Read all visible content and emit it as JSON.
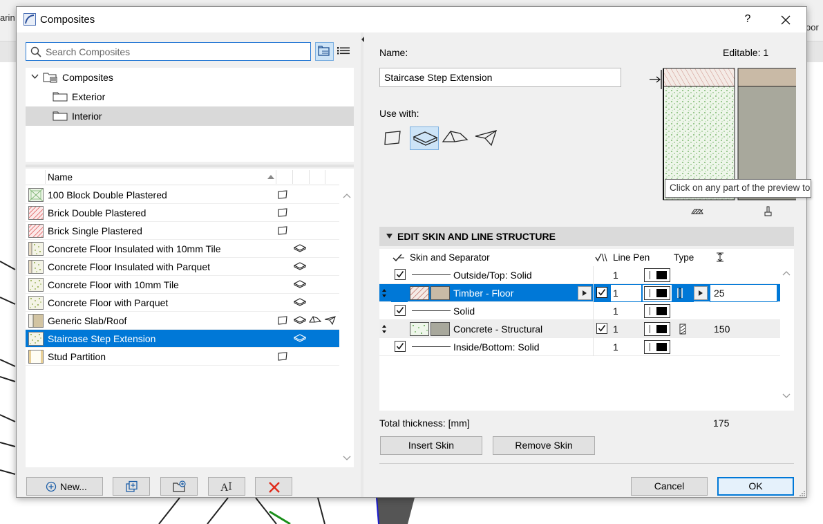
{
  "background": {
    "fragment_left": "arin",
    "fragment_right": "oor"
  },
  "dialog": {
    "title": "Composites",
    "help_label": "?"
  },
  "search": {
    "placeholder": "Search Composites"
  },
  "tree": {
    "root": "Composites",
    "children": [
      "Exterior",
      "Interior"
    ],
    "selected": "Interior"
  },
  "list": {
    "header_name": "Name",
    "rows": [
      {
        "name": "100 Block Double Plastered",
        "swatch": "block",
        "uses": [
          "wall"
        ]
      },
      {
        "name": "Brick Double Plastered",
        "swatch": "brick",
        "uses": [
          "wall"
        ]
      },
      {
        "name": "Brick Single Plastered",
        "swatch": "brick",
        "uses": [
          "wall"
        ]
      },
      {
        "name": "Concrete Floor Insulated with 10mm Tile",
        "swatch": "concrete-insulated",
        "uses": [
          "slab"
        ]
      },
      {
        "name": "Concrete Floor Insulated with Parquet",
        "swatch": "concrete-insulated",
        "uses": [
          "slab"
        ]
      },
      {
        "name": "Concrete Floor with 10mm Tile",
        "swatch": "concrete",
        "uses": [
          "slab"
        ]
      },
      {
        "name": "Concrete Floor with Parquet",
        "swatch": "concrete",
        "uses": [
          "slab"
        ]
      },
      {
        "name": "Generic Slab/Roof",
        "swatch": "generic",
        "uses": [
          "wall",
          "slab",
          "roof",
          "shell"
        ]
      },
      {
        "name": "Staircase Step Extension",
        "swatch": "concrete",
        "uses": [
          "slab"
        ],
        "selected": true
      },
      {
        "name": "Stud Partition",
        "swatch": "stud",
        "uses": [
          "wall"
        ]
      }
    ]
  },
  "left_buttons": {
    "new_label": "New..."
  },
  "details": {
    "name_label": "Name:",
    "editable_label": "Editable: 1",
    "name_value": "Staircase Step Extension",
    "use_with_label": "Use with:",
    "use_with": [
      {
        "icon": "wall-icon",
        "selected": false
      },
      {
        "icon": "slab-icon",
        "selected": true
      },
      {
        "icon": "roof-icon",
        "selected": false
      },
      {
        "icon": "shell-icon",
        "selected": false
      }
    ],
    "tooltip": "Click on any part of the preview to se"
  },
  "structure": {
    "section_title": "EDIT SKIN AND LINE STRUCTURE",
    "headers": {
      "skin": "Skin and Separator",
      "line_pen": "Line Pen",
      "type": "Type"
    },
    "rows": [
      {
        "kind": "separator",
        "label": "Outside/Top: Solid",
        "checked": true,
        "pen": "1"
      },
      {
        "kind": "skin",
        "label": "Timber - Floor",
        "pen": "1",
        "thickness": "25",
        "selected": true,
        "color": "#c9baa6"
      },
      {
        "kind": "separator",
        "label": "Solid",
        "checked": true,
        "pen": "1"
      },
      {
        "kind": "skin",
        "label": "Concrete - Structural",
        "pen": "1",
        "thickness": "150",
        "selected": false,
        "color": "#a8a89c"
      },
      {
        "kind": "separator",
        "label": "Inside/Bottom: Solid",
        "checked": true,
        "pen": "1"
      }
    ],
    "total_label": "Total thickness: [mm]",
    "total_value": "175",
    "insert_label": "Insert Skin",
    "remove_label": "Remove Skin"
  },
  "footer": {
    "cancel_label": "Cancel",
    "ok_label": "OK"
  },
  "colors": {
    "accent": "#0078d7",
    "selection_light": "#cde4f7",
    "timber": "#c9baa6",
    "concrete": "#a8a89c"
  }
}
